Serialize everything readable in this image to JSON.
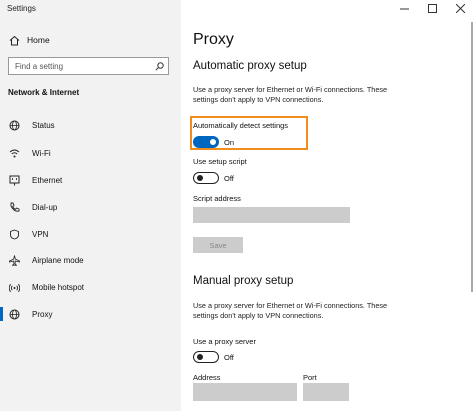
{
  "window": {
    "title": "Settings",
    "minimize_icon": "minimize-icon",
    "maximize_icon": "maximize-icon",
    "close_icon": "close-icon"
  },
  "sidebar": {
    "home_label": "Home",
    "search_placeholder": "Find a setting",
    "section_title": "Network & Internet",
    "items": [
      {
        "label": "Status",
        "icon": "globe-status-icon"
      },
      {
        "label": "Wi-Fi",
        "icon": "wifi-icon"
      },
      {
        "label": "Ethernet",
        "icon": "ethernet-icon"
      },
      {
        "label": "Dial-up",
        "icon": "dialup-icon"
      },
      {
        "label": "VPN",
        "icon": "vpn-icon"
      },
      {
        "label": "Airplane mode",
        "icon": "airplane-icon"
      },
      {
        "label": "Mobile hotspot",
        "icon": "hotspot-icon"
      },
      {
        "label": "Proxy",
        "icon": "globe-icon",
        "selected": true
      }
    ]
  },
  "main": {
    "title": "Proxy",
    "automatic": {
      "heading": "Automatic proxy setup",
      "description": "Use a proxy server for Ethernet or Wi-Fi connections. These settings don't apply to VPN connections.",
      "detect_label": "Automatically detect settings",
      "detect_state": "On",
      "script_label": "Use setup script",
      "script_state": "Off",
      "address_label": "Script address",
      "address_value": "",
      "save_label": "Save"
    },
    "manual": {
      "heading": "Manual proxy setup",
      "description": "Use a proxy server for Ethernet or Wi-Fi connections. These settings don't apply to VPN connections.",
      "use_label": "Use a proxy server",
      "use_state": "Off",
      "address_label": "Address",
      "port_label": "Port",
      "address_value": "",
      "port_value": ""
    }
  },
  "colors": {
    "accent": "#0067c0",
    "highlight": "#f28c1a",
    "sidebar_bg": "#f2f2f2",
    "disabled": "#cccccc"
  }
}
